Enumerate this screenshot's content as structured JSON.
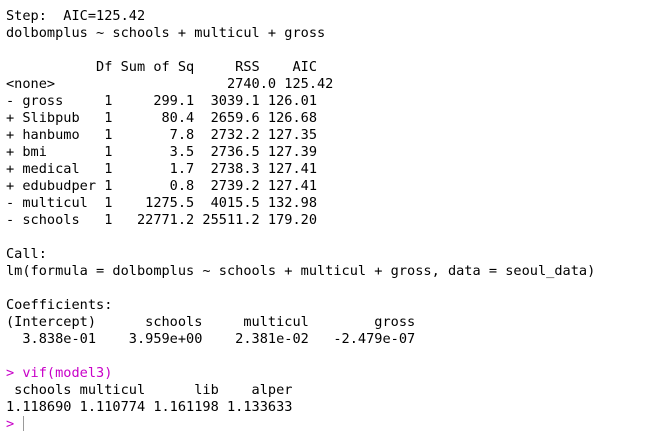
{
  "console": {
    "colors": {
      "text": "#000000",
      "command": "#c800c8",
      "background": "#ffffff"
    },
    "prompt": ">",
    "lines": [
      {
        "text": "Step:  AIC=125.42",
        "kind": "output"
      },
      {
        "text": "dolbomplus ~ schools + multicul + gross",
        "kind": "output"
      },
      {
        "text": "",
        "kind": "blank"
      },
      {
        "text": "           Df Sum of Sq     RSS    AIC",
        "kind": "output"
      },
      {
        "text": "<none>                     2740.0 125.42",
        "kind": "output"
      },
      {
        "text": "- gross     1     299.1  3039.1 126.01",
        "kind": "output"
      },
      {
        "text": "+ Slibpub   1      80.4  2659.6 126.68",
        "kind": "output"
      },
      {
        "text": "+ hanbumo   1       7.8  2732.2 127.35",
        "kind": "output"
      },
      {
        "text": "+ bmi       1       3.5  2736.5 127.39",
        "kind": "output"
      },
      {
        "text": "+ medical   1       1.7  2738.3 127.41",
        "kind": "output"
      },
      {
        "text": "+ edubudper 1       0.8  2739.2 127.41",
        "kind": "output"
      },
      {
        "text": "- multicul  1    1275.5  4015.5 132.98",
        "kind": "output"
      },
      {
        "text": "- schools   1   22771.2 25511.2 179.20",
        "kind": "output"
      },
      {
        "text": "",
        "kind": "blank"
      },
      {
        "text": "Call:",
        "kind": "output"
      },
      {
        "text": "lm(formula = dolbomplus ~ schools + multicul + gross, data = seoul_data)",
        "kind": "output"
      },
      {
        "text": "",
        "kind": "blank"
      },
      {
        "text": "Coefficients:",
        "kind": "output"
      },
      {
        "text": "(Intercept)      schools     multicul        gross  ",
        "kind": "output"
      },
      {
        "text": "  3.838e-01    3.959e+00    2.381e-02   -2.479e-07  ",
        "kind": "output"
      },
      {
        "text": "",
        "kind": "blank"
      },
      {
        "text": "> vif(model3)",
        "kind": "command"
      },
      {
        "text": " schools multicul      lib    alper ",
        "kind": "output"
      },
      {
        "text": "1.118690 1.110774 1.161198 1.133633 ",
        "kind": "output"
      }
    ]
  }
}
